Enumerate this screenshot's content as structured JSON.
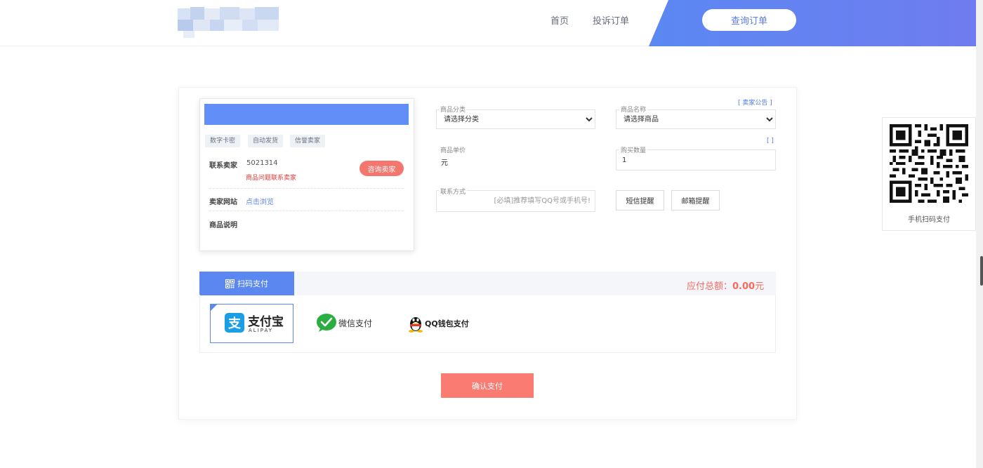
{
  "header": {
    "nav": [
      "首页",
      "投诉订单"
    ],
    "query_button": "查询订单"
  },
  "seller": {
    "tags": [
      "数字卡密",
      "自动发货",
      "信誉卖家"
    ],
    "contact_label": "联系卖家",
    "contact_value": "5021314",
    "warning": "商品问题联系卖家",
    "consult_button": "咨询卖家",
    "site_label": "卖家网站",
    "site_link": "点击浏览",
    "desc_label": "商品说明"
  },
  "form": {
    "notice_link": "[ 卖家公告 ]",
    "category_label": "商品分类",
    "category_value": "请选择分类",
    "product_label": "商品名称",
    "product_value": "请选择商品",
    "qty_bracket": "[ ]",
    "price_label": "商品单价",
    "price_value": "元",
    "qty_label": "购买数量",
    "qty_value": "1",
    "contact_label": "联系方式",
    "contact_placeholder": "[必填]推荐填写QQ号或手机号!",
    "sms_button": "短信提醒",
    "email_button": "邮箱提醒"
  },
  "payment": {
    "tab_label": "扫码支付",
    "total_label": "应付总额：",
    "total_value": "0.00",
    "total_unit": "元",
    "alipay_text": "支付宝",
    "alipay_sub": "ALIPAY",
    "wechat_text": "微信支付",
    "qq_text": "QQ钱包支付",
    "confirm_button": "确认支付"
  },
  "qr": {
    "caption": "手机扫码支付"
  },
  "colors": {
    "primary_blue": "#5b88f0",
    "coral": "#f97b72",
    "alipay_blue": "#1a9fe6",
    "wechat_green": "#2aae3f"
  }
}
